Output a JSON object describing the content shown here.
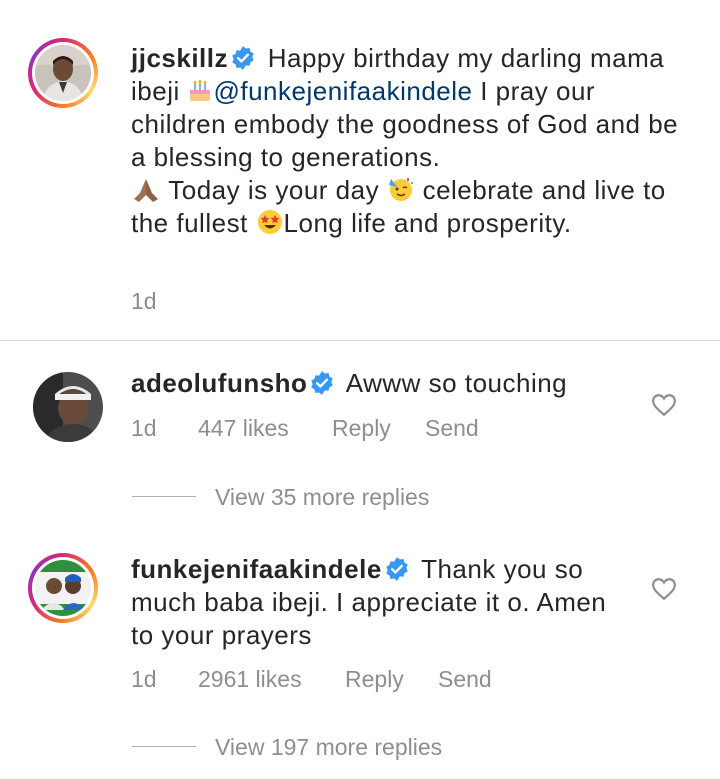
{
  "caption": {
    "username": "jjcskillz",
    "text_part1": "Happy birthday my darling mama ibeji",
    "mention": "@funkejenifaakindele",
    "text_part2": "I pray our children embody the goodness of God and be a blessing to generations.",
    "text_part3": "Today is your day",
    "text_part4": "celebrate and live to the fullest",
    "text_part5": "Long life and prosperity.",
    "time": "1d"
  },
  "comments": [
    {
      "username": "adeolufunsho",
      "text": "Awww so touching",
      "time": "1d",
      "likes": "447 likes",
      "reply": "Reply",
      "send": "Send",
      "view_replies": "View 35 more replies"
    },
    {
      "username": "funkejenifaakindele",
      "text": "Thank you so much baba ibeji. I appreciate it o. Amen to your prayers",
      "time": "1d",
      "likes": "2961 likes",
      "reply": "Reply",
      "send": "Send",
      "view_replies": "View 197 more replies"
    }
  ],
  "colors": {
    "mention": "#00376b",
    "verified": "#3897f0",
    "meta": "#8e8e8e"
  },
  "icons": [
    "verified-icon",
    "cake-emoji",
    "praying-hands-emoji",
    "party-face-emoji",
    "star-struck-emoji",
    "heart-icon"
  ]
}
